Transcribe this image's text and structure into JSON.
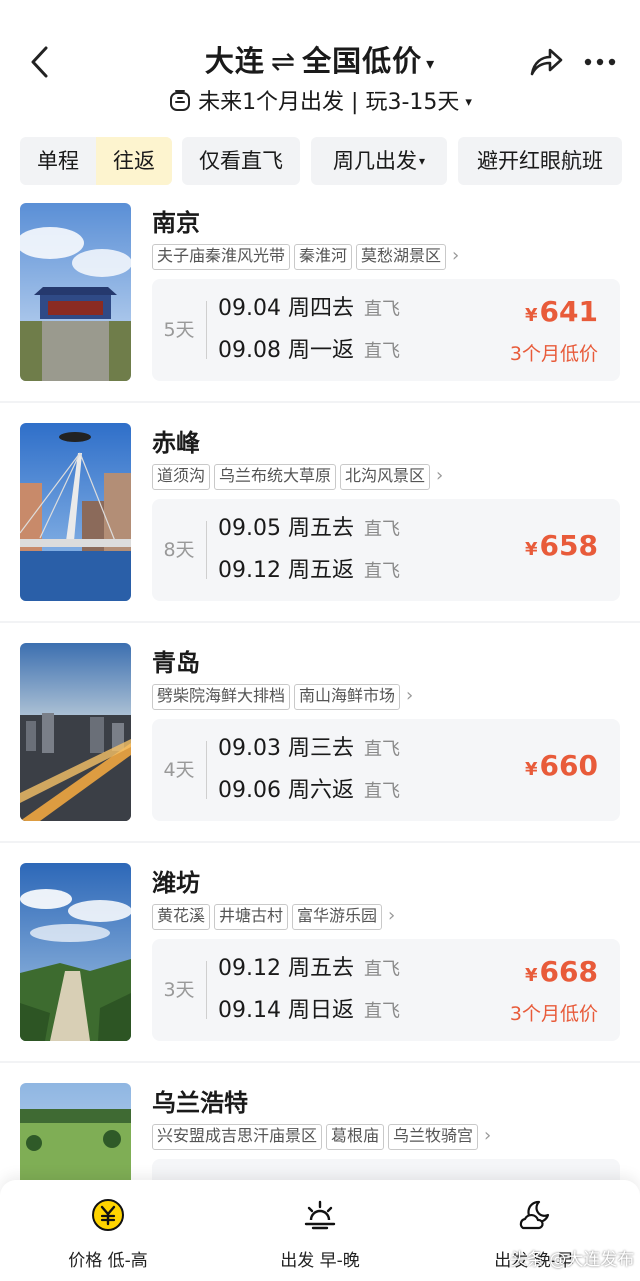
{
  "header": {
    "origin": "大连",
    "swap_symbol": "⇌",
    "destination": "全国低价",
    "caret": "▾",
    "subtitle": "未来1个月出发 | 玩3-15天",
    "subtitle_caret": "▾"
  },
  "filters": {
    "one_way": "单程",
    "round_trip": "往返",
    "direct_only": "仅看直飞",
    "weekday": "周几出发",
    "weekday_caret": "▾",
    "avoid_redeye": "避开红眼航班"
  },
  "items": [
    {
      "city": "南京",
      "tags": [
        "夫子庙秦淮风光带",
        "秦淮河",
        "莫愁湖景区"
      ],
      "days": "5天",
      "depart": "09.04  周四去",
      "return": "09.08  周一返",
      "flight_type_out": "直飞",
      "flight_type_back": "直飞",
      "price": "641",
      "low_label": "3个月低价"
    },
    {
      "city": "赤峰",
      "tags": [
        "道须沟",
        "乌兰布统大草原",
        "北沟风景区"
      ],
      "days": "8天",
      "depart": "09.05  周五去",
      "return": "09.12  周五返",
      "flight_type_out": "直飞",
      "flight_type_back": "直飞",
      "price": "658",
      "low_label": ""
    },
    {
      "city": "青岛",
      "tags": [
        "劈柴院海鲜大排档",
        "南山海鲜市场"
      ],
      "days": "4天",
      "depart": "09.03  周三去",
      "return": "09.06  周六返",
      "flight_type_out": "直飞",
      "flight_type_back": "直飞",
      "price": "660",
      "low_label": ""
    },
    {
      "city": "潍坊",
      "tags": [
        "黄花溪",
        "井塘古村",
        "富华游乐园"
      ],
      "days": "3天",
      "depart": "09.12  周五去",
      "return": "09.14  周日返",
      "flight_type_out": "直飞",
      "flight_type_back": "直飞",
      "price": "668",
      "low_label": "3个月低价"
    },
    {
      "city": "乌兰浩特",
      "tags": [
        "兴安盟成吉思汗庙景区",
        "葛根庙",
        "乌兰牧骑宫"
      ]
    }
  ],
  "currency": "¥",
  "bottom_tabs": {
    "price": "价格 低-高",
    "depart": "出发 早-晚",
    "arrive": "出发 晚-早"
  },
  "watermark": "头条 @大连发布",
  "colors": {
    "accent": "#e85b3a",
    "highlight": "#fdf4cf",
    "brand_yellow": "#ffd400"
  }
}
